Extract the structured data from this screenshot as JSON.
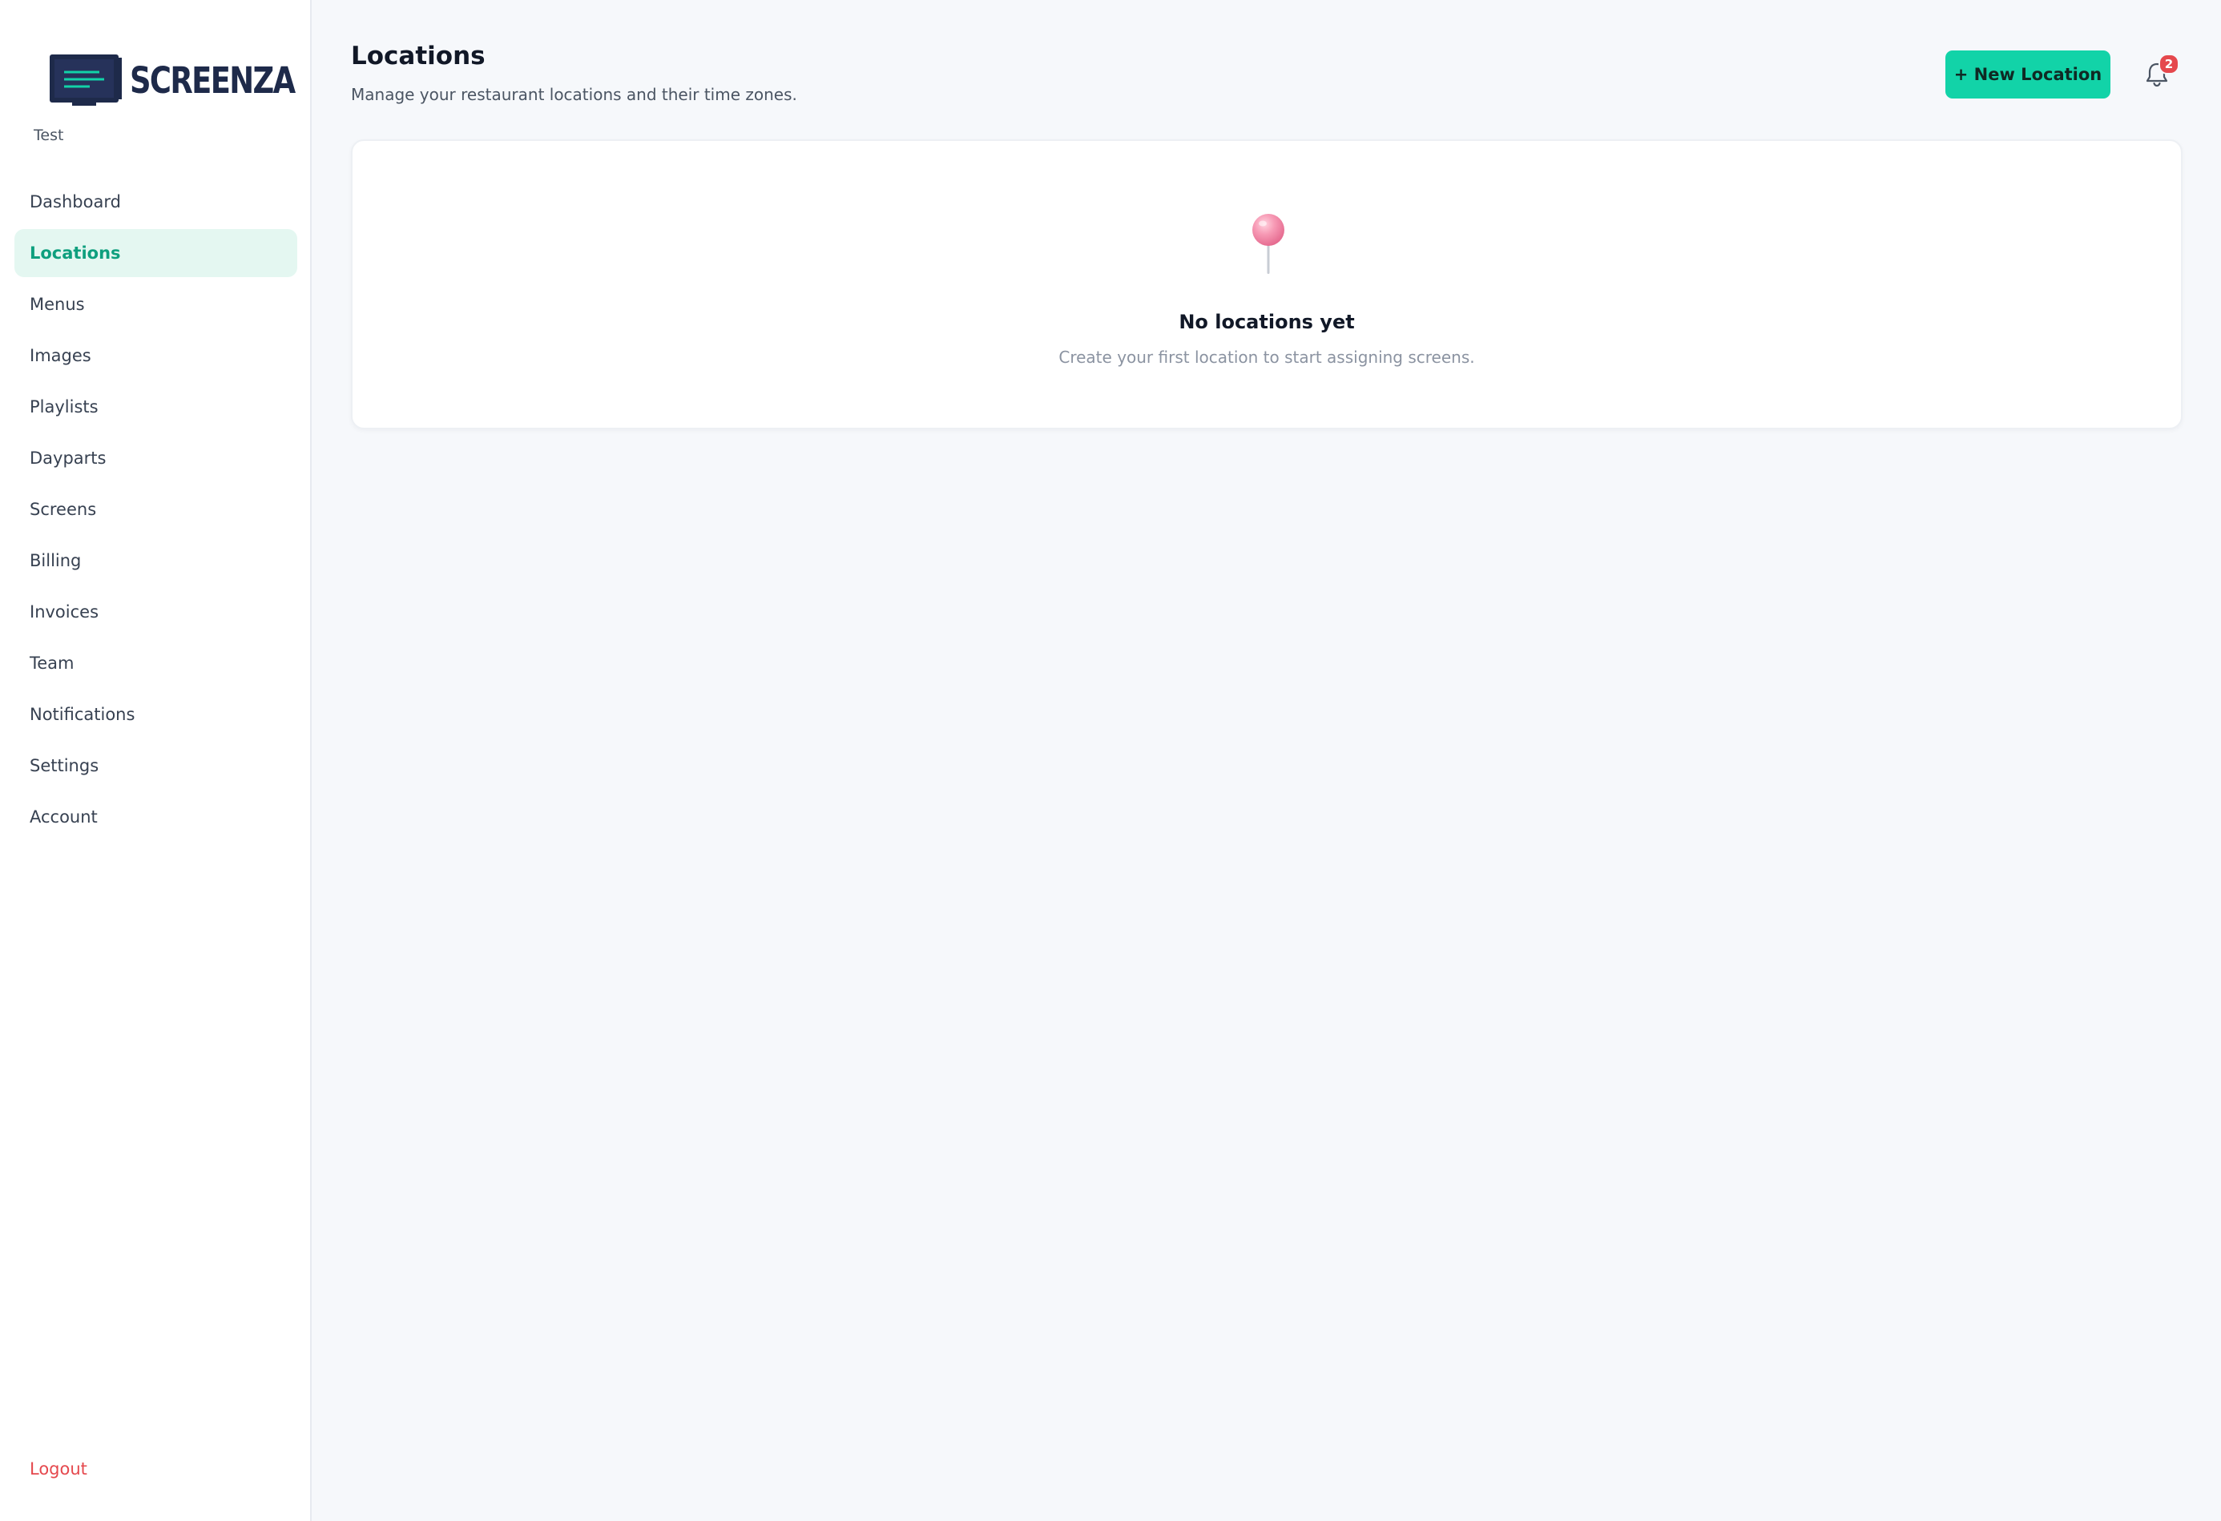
{
  "brand": {
    "name": "SCREENZA",
    "icon": "tv-screen-logo-icon",
    "org_name": "Test"
  },
  "sidebar": {
    "items": [
      {
        "label": "Dashboard",
        "active": false
      },
      {
        "label": "Locations",
        "active": true
      },
      {
        "label": "Menus",
        "active": false
      },
      {
        "label": "Images",
        "active": false
      },
      {
        "label": "Playlists",
        "active": false
      },
      {
        "label": "Dayparts",
        "active": false
      },
      {
        "label": "Screens",
        "active": false
      },
      {
        "label": "Billing",
        "active": false
      },
      {
        "label": "Invoices",
        "active": false
      },
      {
        "label": "Team",
        "active": false
      },
      {
        "label": "Notifications",
        "active": false
      },
      {
        "label": "Settings",
        "active": false
      },
      {
        "label": "Account",
        "active": false
      }
    ],
    "logout_label": "Logout"
  },
  "header": {
    "title": "Locations",
    "subtitle": "Manage your restaurant locations and their time zones.",
    "new_button_label": "+ New Location",
    "notifications_icon": "bell-icon",
    "notification_count": "2"
  },
  "empty_state": {
    "icon": "pushpin-icon",
    "title": "No locations yet",
    "text": "Create your first location to start assigning screens."
  },
  "colors": {
    "accent": "#12d3a8",
    "active_nav_bg": "#e4f7f1",
    "active_nav_text": "#0e9f7e",
    "brand_navy": "#1e2a4a",
    "danger": "#e5484d",
    "page_bg": "#f6f8fb"
  }
}
